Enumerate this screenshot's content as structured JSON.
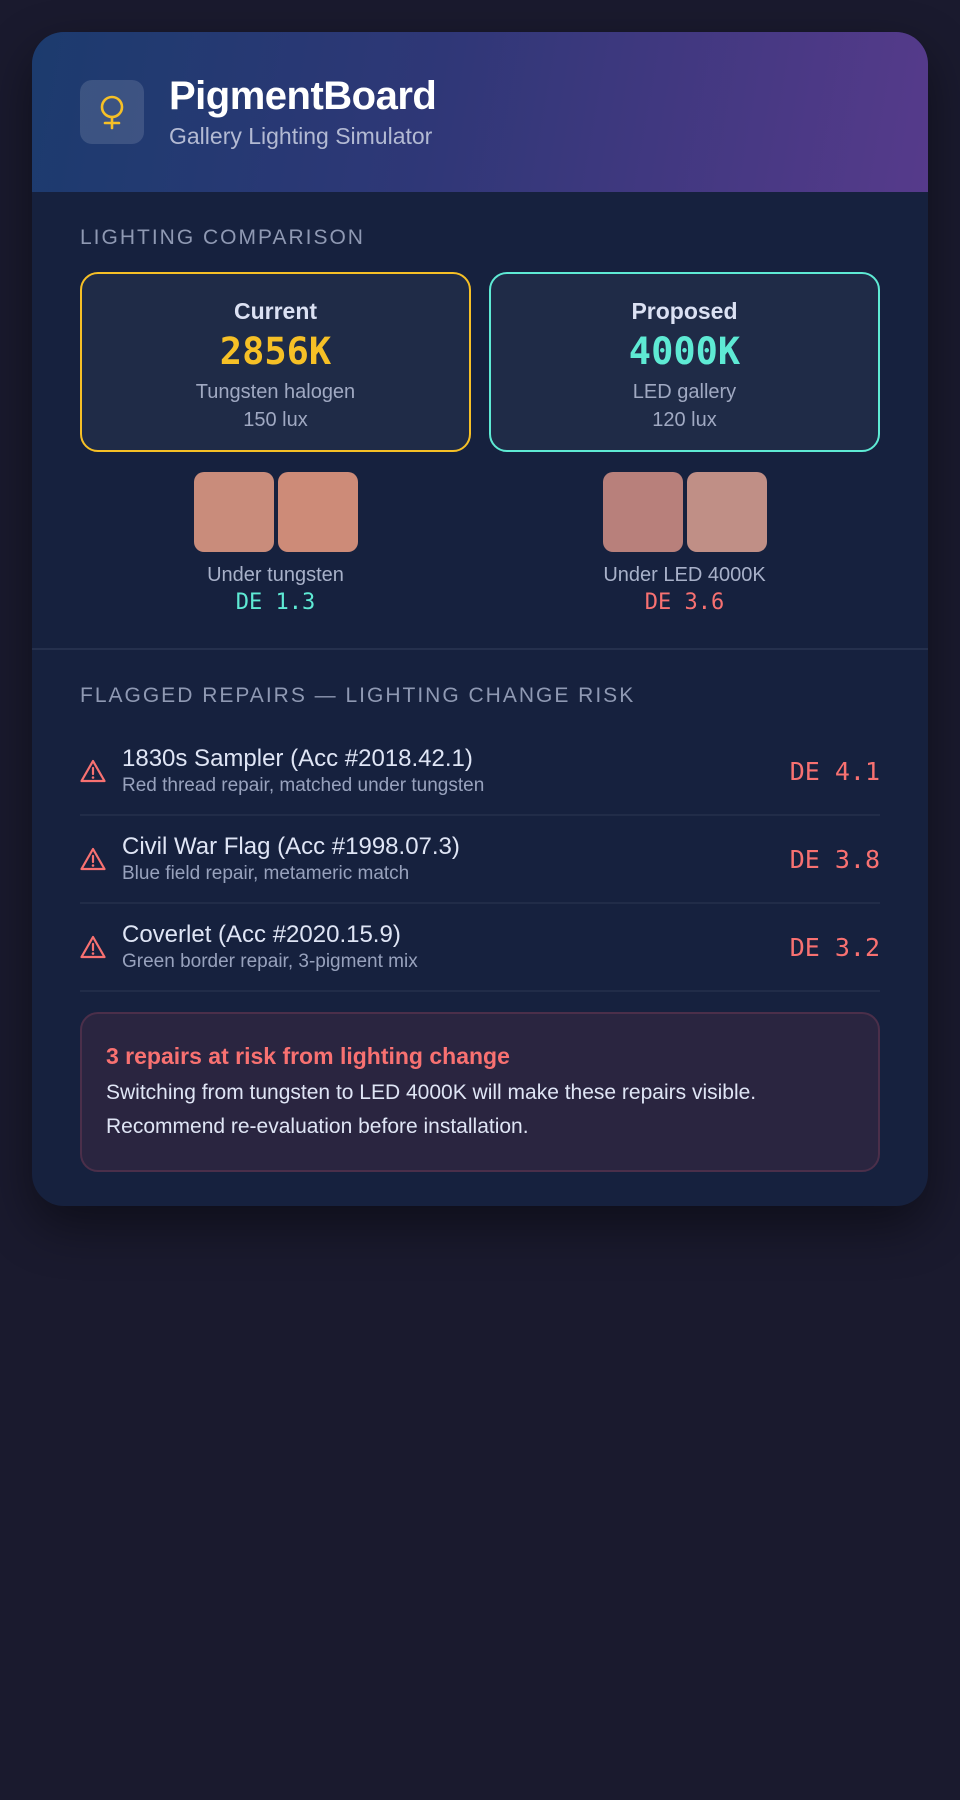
{
  "header": {
    "logo_icon": "bulb-icon",
    "title": "PigmentBoard",
    "subtitle": "Gallery Lighting Simulator"
  },
  "lighting": {
    "section_title": "LIGHTING COMPARISON",
    "current": {
      "label": "Current",
      "temperature": "2856K",
      "source": "Tungsten halogen",
      "lux": "150 lux",
      "accent": "#f6c026"
    },
    "proposed": {
      "label": "Proposed",
      "temperature": "4000K",
      "source": "LED gallery",
      "lux": "120 lux",
      "accent": "#5eead4"
    },
    "comparisons": [
      {
        "caption": "Under tungsten",
        "delta_e": "DE 1.3",
        "swatch_colors": [
          "#c98c7b",
          "#cd8b78"
        ]
      },
      {
        "caption": "Under LED 4000K",
        "delta_e": "DE 3.6",
        "swatch_colors": [
          "#b8807b",
          "#c08f86"
        ]
      }
    ]
  },
  "repairs": {
    "section_title": "FLAGGED REPAIRS — LIGHTING CHANGE RISK",
    "items": [
      {
        "icon": "warning-icon",
        "name": "1830s Sampler (Acc #2018.42.1)",
        "description": "Red thread repair, matched under tungsten",
        "delta_e": "DE 4.1"
      },
      {
        "icon": "warning-icon",
        "name": "Civil War Flag (Acc #1998.07.3)",
        "description": "Blue field repair, metameric match",
        "delta_e": "DE 3.8"
      },
      {
        "icon": "warning-icon",
        "name": "Coverlet (Acc #2020.15.9)",
        "description": "Green border repair, 3-pigment mix",
        "delta_e": "DE 3.2"
      }
    ]
  },
  "alert": {
    "title": "3 repairs at risk from lighting change",
    "body": "Switching from tungsten to LED 4000K will make these repairs visible. Recommend re-evaluation before installation."
  },
  "colors": {
    "background": "#1a1a2e",
    "card": "#16213e",
    "warning": "#f87171",
    "good": "#5eead4"
  }
}
